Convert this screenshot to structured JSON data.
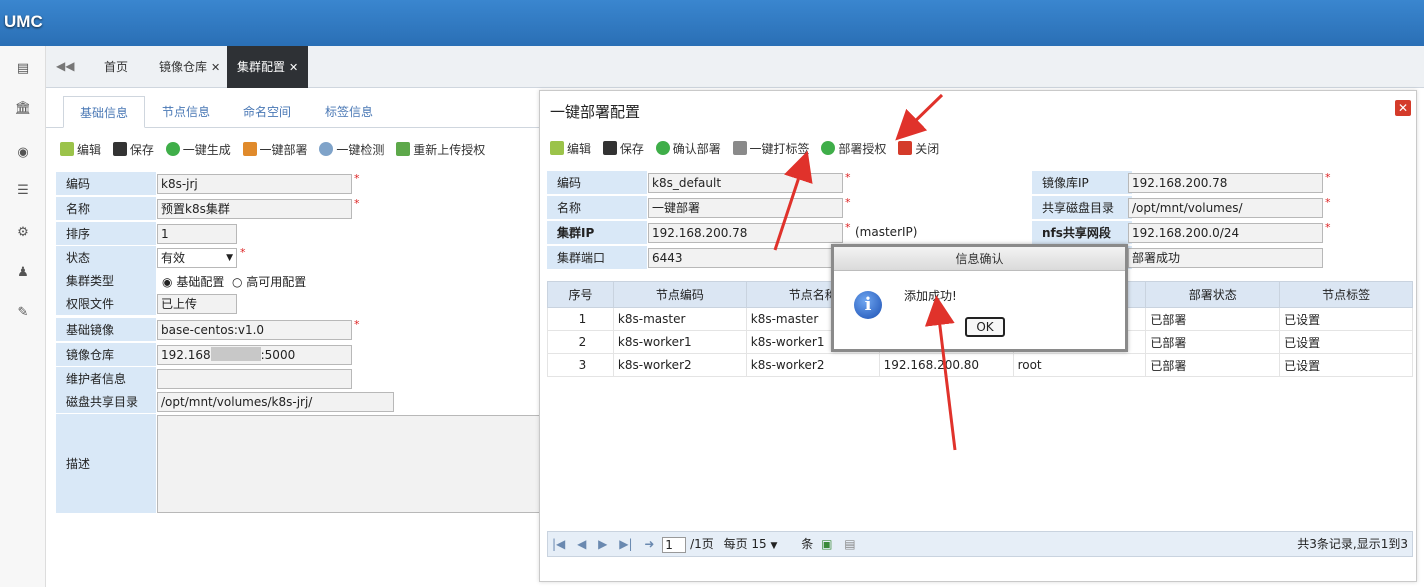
{
  "app": {
    "logo": "UMC"
  },
  "tabs": {
    "nav": "◀◀",
    "items": [
      {
        "label": "首页"
      },
      {
        "label": "镜像仓库",
        "close": "✕"
      },
      {
        "label": "集群配置",
        "close": "✕"
      }
    ]
  },
  "subtabs": [
    "基础信息",
    "节点信息",
    "命名空间",
    "标签信息"
  ],
  "toolbar": [
    "编辑",
    "保存",
    "一键生成",
    "一键部署",
    "一键检测",
    "重新上传授权"
  ],
  "form": {
    "labels": [
      "编码",
      "名称",
      "排序",
      "状态",
      "集群类型",
      "权限文件",
      "基础镜像",
      "镜像仓库",
      "维护者信息",
      "磁盘共享目录",
      "描述"
    ],
    "code": "k8s-jrj",
    "name": "预置k8s集群",
    "order": "1",
    "status": "有效",
    "type_a": "基础配置",
    "type_b": "高可用配置",
    "perm": "已上传",
    "base_image": "base-centos:v1.0",
    "registry_prefix": "192.168",
    "registry_suffix": ":5000",
    "share_dir": "/opt/mnt/volumes/k8s-jrj/",
    "req": "*"
  },
  "dialog": {
    "title": "一键部署配置",
    "close": "✕",
    "toolbar": [
      "编辑",
      "保存",
      "确认部署",
      "一键打标签",
      "部署授权",
      "关闭"
    ],
    "labels_left": [
      "编码",
      "名称",
      "集群IP",
      "集群端口"
    ],
    "values_left": [
      "k8s_default",
      "一键部署",
      "192.168.200.78",
      "6443"
    ],
    "master_note": "(masterIP)",
    "labels_right": [
      "镜像库IP",
      "共享磁盘目录",
      "nfs共享网段",
      ""
    ],
    "values_right": [
      "192.168.200.78",
      "/opt/mnt/volumes/",
      "192.168.200.0/24",
      "部署成功"
    ],
    "req": "*",
    "grid": {
      "headers": [
        "序号",
        "节点编码",
        "节点名称",
        "",
        "",
        "部署状态",
        "节点标签"
      ],
      "rows": [
        [
          "1",
          "k8s-master",
          "k8s-master",
          "",
          "",
          "已部署",
          "已设置"
        ],
        [
          "2",
          "k8s-worker1",
          "k8s-worker1",
          "",
          "",
          "已部署",
          "已设置"
        ],
        [
          "3",
          "k8s-worker2",
          "k8s-worker2",
          "192.168.200.80",
          "root",
          "已部署",
          "已设置"
        ]
      ]
    },
    "pager": {
      "page": "1",
      "total_pages": "/1页",
      "per_page_label": "每页",
      "per_page": "15",
      "unit": "条",
      "summary": "共3条记录,显示1到3"
    }
  },
  "msgbox": {
    "title": "信息确认",
    "message": "添加成功!",
    "ok": "OK"
  },
  "colors": {
    "topbar": "#2a6fb5",
    "label_bg": "#d9e8f7",
    "arrow": "#e0322b"
  }
}
